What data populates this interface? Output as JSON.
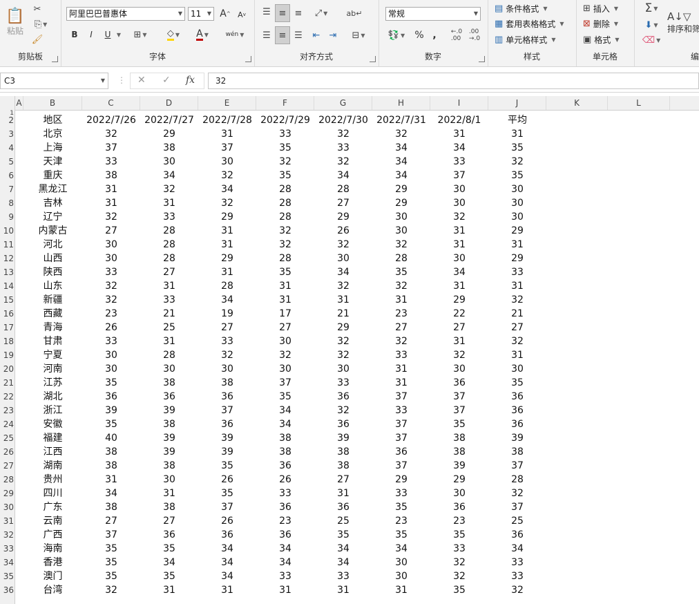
{
  "ribbon": {
    "clipboard": {
      "paste_label": "粘贴",
      "group_label": "剪贴板"
    },
    "font": {
      "font_name": "阿里巴巴普惠体",
      "font_size": "11",
      "group_label": "字体",
      "bold": "B",
      "italic": "I",
      "underline": "U",
      "grow": "A",
      "shrink": "A",
      "font_color": "A",
      "phonetic": "wén"
    },
    "alignment": {
      "group_label": "对齐方式"
    },
    "number": {
      "format": "常规",
      "group_label": "数字",
      "percent": "%",
      "comma": ","
    },
    "styles": {
      "conditional": "条件格式",
      "table": "套用表格格式",
      "cell_styles": "单元格样式",
      "group_label": "样式"
    },
    "cells": {
      "insert": "插入",
      "delete": "删除",
      "format": "格式",
      "group_label": "单元格"
    },
    "editing": {
      "sort": "排序和筛",
      "group_label": "编"
    }
  },
  "formula_bar": {
    "name_box": "C3",
    "value": "32",
    "fx": "fx"
  },
  "columns": [
    "A",
    "B",
    "C",
    "D",
    "E",
    "F",
    "G",
    "H",
    "I",
    "J",
    "K",
    "L"
  ],
  "header_row": [
    "地区",
    "2022/7/26",
    "2022/7/27",
    "2022/7/28",
    "2022/7/29",
    "2022/7/30",
    "2022/7/31",
    "2022/8/1",
    "平均"
  ],
  "rows": [
    [
      "北京",
      "32",
      "29",
      "31",
      "33",
      "32",
      "32",
      "31",
      "31"
    ],
    [
      "上海",
      "37",
      "38",
      "37",
      "35",
      "33",
      "34",
      "34",
      "35"
    ],
    [
      "天津",
      "33",
      "30",
      "30",
      "32",
      "32",
      "34",
      "33",
      "32"
    ],
    [
      "重庆",
      "38",
      "34",
      "32",
      "35",
      "34",
      "34",
      "37",
      "35"
    ],
    [
      "黑龙江",
      "31",
      "32",
      "34",
      "28",
      "28",
      "29",
      "30",
      "30"
    ],
    [
      "吉林",
      "31",
      "31",
      "32",
      "28",
      "27",
      "29",
      "30",
      "30"
    ],
    [
      "辽宁",
      "32",
      "33",
      "29",
      "28",
      "29",
      "30",
      "32",
      "30"
    ],
    [
      "内蒙古",
      "27",
      "28",
      "31",
      "32",
      "26",
      "30",
      "31",
      "29"
    ],
    [
      "河北",
      "30",
      "28",
      "31",
      "32",
      "32",
      "32",
      "31",
      "31"
    ],
    [
      "山西",
      "30",
      "28",
      "29",
      "28",
      "30",
      "28",
      "30",
      "29"
    ],
    [
      "陕西",
      "33",
      "27",
      "31",
      "35",
      "34",
      "35",
      "34",
      "33"
    ],
    [
      "山东",
      "32",
      "31",
      "28",
      "31",
      "32",
      "32",
      "31",
      "31"
    ],
    [
      "新疆",
      "32",
      "33",
      "34",
      "31",
      "31",
      "31",
      "29",
      "32"
    ],
    [
      "西藏",
      "23",
      "21",
      "19",
      "17",
      "21",
      "23",
      "22",
      "21"
    ],
    [
      "青海",
      "26",
      "25",
      "27",
      "27",
      "29",
      "27",
      "27",
      "27"
    ],
    [
      "甘肃",
      "33",
      "31",
      "33",
      "30",
      "32",
      "32",
      "31",
      "32"
    ],
    [
      "宁夏",
      "30",
      "28",
      "32",
      "32",
      "32",
      "33",
      "32",
      "31"
    ],
    [
      "河南",
      "30",
      "30",
      "30",
      "30",
      "30",
      "31",
      "30",
      "30"
    ],
    [
      "江苏",
      "35",
      "38",
      "38",
      "37",
      "33",
      "31",
      "36",
      "35"
    ],
    [
      "湖北",
      "36",
      "36",
      "36",
      "35",
      "36",
      "37",
      "37",
      "36"
    ],
    [
      "浙江",
      "39",
      "39",
      "37",
      "34",
      "32",
      "33",
      "37",
      "36"
    ],
    [
      "安徽",
      "35",
      "38",
      "36",
      "34",
      "36",
      "37",
      "35",
      "36"
    ],
    [
      "福建",
      "40",
      "39",
      "39",
      "38",
      "39",
      "37",
      "38",
      "39"
    ],
    [
      "江西",
      "38",
      "39",
      "39",
      "38",
      "38",
      "36",
      "38",
      "38"
    ],
    [
      "湖南",
      "38",
      "38",
      "35",
      "36",
      "38",
      "37",
      "39",
      "37"
    ],
    [
      "贵州",
      "31",
      "30",
      "26",
      "26",
      "27",
      "29",
      "29",
      "28"
    ],
    [
      "四川",
      "34",
      "31",
      "35",
      "33",
      "31",
      "33",
      "30",
      "32"
    ],
    [
      "广东",
      "38",
      "38",
      "37",
      "36",
      "36",
      "35",
      "36",
      "37"
    ],
    [
      "云南",
      "27",
      "27",
      "26",
      "23",
      "25",
      "23",
      "23",
      "25"
    ],
    [
      "广西",
      "37",
      "36",
      "36",
      "36",
      "35",
      "35",
      "35",
      "36"
    ],
    [
      "海南",
      "35",
      "35",
      "34",
      "34",
      "34",
      "34",
      "33",
      "34"
    ],
    [
      "香港",
      "35",
      "34",
      "34",
      "34",
      "34",
      "30",
      "32",
      "33"
    ],
    [
      "澳门",
      "35",
      "35",
      "34",
      "33",
      "33",
      "30",
      "32",
      "33"
    ],
    [
      "台湾",
      "32",
      "31",
      "31",
      "31",
      "31",
      "31",
      "35",
      "32"
    ]
  ]
}
